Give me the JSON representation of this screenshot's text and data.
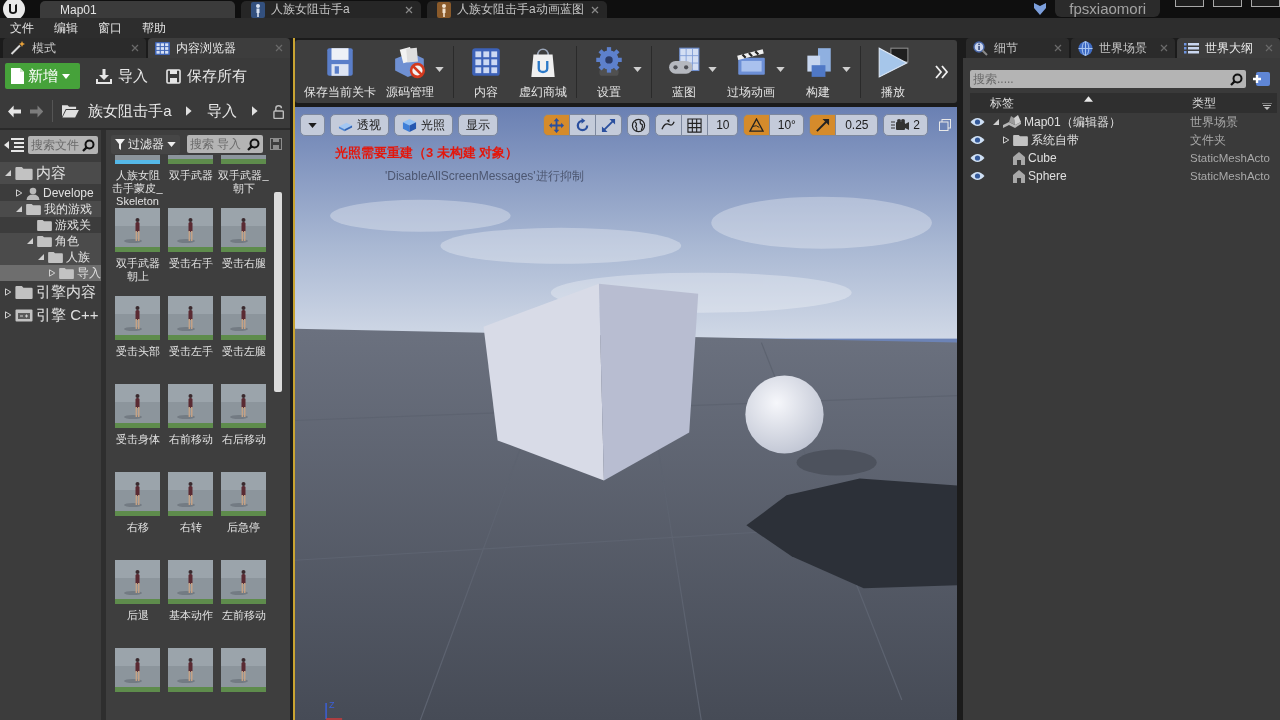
{
  "title_bar": {
    "tabs": [
      {
        "label": "Map01",
        "selected": true,
        "kind": "level"
      },
      {
        "label": "人族女阻击手a",
        "selected": false,
        "kind": "skeleton"
      },
      {
        "label": "人族女阻击手a动画蓝图",
        "selected": false,
        "kind": "anim_blueprint"
      }
    ],
    "user": "fpsxiaomori"
  },
  "menu": [
    "文件",
    "编辑",
    "窗口",
    "帮助"
  ],
  "left_panel": {
    "tabs": [
      {
        "label": "模式",
        "selected": false,
        "kind": "modes"
      },
      {
        "label": "内容浏览器",
        "selected": true,
        "kind": "content"
      }
    ],
    "actions": [
      {
        "label": "新增",
        "kind": "add"
      },
      {
        "label": "导入",
        "kind": "import"
      },
      {
        "label": "保存所有",
        "kind": "save"
      }
    ],
    "path": [
      "族女阻击手a",
      "导入"
    ],
    "folder_search": {
      "placeholder": "搜索文件"
    },
    "folders": [
      {
        "label": "内容",
        "kind": "folder",
        "expanded": true,
        "selected": false,
        "children": [
          {
            "label": "Develope",
            "kind": "user",
            "expanded": false,
            "selected": false
          },
          {
            "label": "我的游戏",
            "kind": "folder",
            "expanded": true,
            "selected": false,
            "children": [
              {
                "label": "游戏关",
                "kind": "folder",
                "selected": false
              },
              {
                "label": "角色",
                "kind": "folder",
                "expanded": true,
                "selected": false,
                "children": [
                  {
                    "label": "人族",
                    "kind": "folder",
                    "expanded": true,
                    "selected": false,
                    "children": [
                      {
                        "label": "导入",
                        "kind": "folder",
                        "expanded": false,
                        "selected": true
                      }
                    ]
                  }
                ]
              }
            ]
          }
        ]
      },
      {
        "label": "引擎内容",
        "kind": "folder",
        "expanded": false,
        "selected": false
      },
      {
        "label": "引擎 C++",
        "kind": "code",
        "expanded": false,
        "selected": false
      }
    ],
    "filter": "过滤器",
    "asset_search": {
      "placeholder": "搜索 导入"
    },
    "assets": [
      {
        "label": "人族女阻击手蒙皮_Skeleton",
        "kind": "skeleton"
      },
      {
        "label": "双手武器",
        "kind": "animation"
      },
      {
        "label": "双手武器_朝下",
        "kind": "animation"
      },
      {
        "label": "双手武器朝上",
        "kind": "animation"
      },
      {
        "label": "受击右手",
        "kind": "animation"
      },
      {
        "label": "受击右腿",
        "kind": "animation"
      },
      {
        "label": "受击头部",
        "kind": "animation"
      },
      {
        "label": "受击左手",
        "kind": "animation"
      },
      {
        "label": "受击左腿",
        "kind": "animation"
      },
      {
        "label": "受击身体",
        "kind": "animation"
      },
      {
        "label": "右前移动",
        "kind": "animation"
      },
      {
        "label": "右后移动",
        "kind": "animation"
      },
      {
        "label": "右移",
        "kind": "animation"
      },
      {
        "label": "右转",
        "kind": "animation"
      },
      {
        "label": "后急停",
        "kind": "animation"
      },
      {
        "label": "后退",
        "kind": "animation"
      },
      {
        "label": "基本动作",
        "kind": "animation"
      },
      {
        "label": "左前移动",
        "kind": "animation"
      },
      {
        "kind": "animation"
      },
      {
        "kind": "animation"
      },
      {
        "kind": "animation"
      }
    ]
  },
  "toolbar": [
    [
      {
        "label": "保存当前关卡",
        "kind": "save",
        "dropdown": false
      },
      {
        "label": "源码管理",
        "kind": "source_control",
        "dropdown": true
      }
    ],
    [
      {
        "label": "内容",
        "kind": "content",
        "dropdown": false
      },
      {
        "label": "虚幻商城",
        "kind": "marketplace",
        "dropdown": false
      }
    ],
    [
      {
        "label": "设置",
        "kind": "settings",
        "dropdown": true
      }
    ],
    [
      {
        "label": "蓝图",
        "kind": "blueprint",
        "dropdown": true
      },
      {
        "label": "过场动画",
        "kind": "cinematics",
        "dropdown": true
      },
      {
        "label": "构建",
        "kind": "build",
        "dropdown": true
      }
    ],
    [
      {
        "label": "播放",
        "kind": "play",
        "dropdown": false
      }
    ]
  ],
  "viewport": {
    "toolbar": {
      "views": [
        {
          "label": "透视",
          "kind": "perspective"
        },
        {
          "label": "光照",
          "kind": "lit"
        },
        {
          "label": "显示",
          "kind": "show"
        }
      ],
      "transform": [
        {
          "kind": "move",
          "selected": true
        },
        {
          "kind": "rotate",
          "selected": false
        },
        {
          "kind": "scale",
          "selected": false
        }
      ],
      "grid_snap": {
        "on": false,
        "value": "10"
      },
      "rotation_snap": {
        "on": true,
        "value": "10°"
      },
      "scale_snap": {
        "on": true,
        "value": "0.25"
      },
      "camera_speed": "2"
    },
    "messages": [
      {
        "text": "光照需要重建（3 未构建 对象）",
        "kind": "error"
      },
      {
        "text": "'DisableAllScreenMessages'进行抑制",
        "kind": "hint"
      }
    ],
    "axis_label": "Z"
  },
  "right_panel": {
    "tabs": [
      {
        "label": "细节",
        "selected": false,
        "kind": "details"
      },
      {
        "label": "世界场景",
        "selected": false,
        "kind": "world"
      },
      {
        "label": "世界大纲",
        "selected": true,
        "kind": "outliner"
      }
    ],
    "search": {
      "placeholder": "搜索....."
    },
    "columns": [
      "标签",
      "类型"
    ],
    "rows": [
      {
        "label": "Map01（编辑器）",
        "type": "世界场景",
        "kind": "level",
        "visible": true,
        "expanded": true,
        "children": [
          {
            "label": "系统自带",
            "type": "文件夹",
            "kind": "folder",
            "visible": true,
            "expanded": false
          },
          {
            "label": "Cube",
            "type": "StaticMeshActo",
            "kind": "actor",
            "visible": true
          },
          {
            "label": "Sphere",
            "type": "StaticMeshActo",
            "kind": "actor",
            "visible": true
          }
        ]
      }
    ]
  }
}
